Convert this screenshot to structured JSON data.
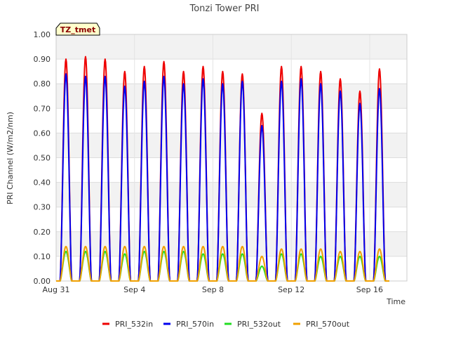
{
  "chart_data": {
    "type": "line",
    "title": "Tonzi Tower PRI",
    "xlabel": "Time",
    "ylabel": "PRI Channel (W/m2/nm)",
    "annotation": "TZ_tmet",
    "ylim": [
      0,
      1.0
    ],
    "yticks": [
      "0.00",
      "0.10",
      "0.20",
      "0.30",
      "0.40",
      "0.50",
      "0.60",
      "0.70",
      "0.80",
      "0.90",
      "1.00"
    ],
    "x_start": "Aug 31",
    "x_end": "Sep 18",
    "xticks": [
      {
        "day": 0,
        "label": "Aug 31"
      },
      {
        "day": 4,
        "label": "Sep 4"
      },
      {
        "day": 8,
        "label": "Sep 8"
      },
      {
        "day": 12,
        "label": "Sep 12"
      },
      {
        "day": 16,
        "label": "Sep 16"
      }
    ],
    "grid": true,
    "legend_position": "bottom",
    "daily_peaks": {
      "days": [
        "Aug 31",
        "Sep 1",
        "Sep 2",
        "Sep 3",
        "Sep 4",
        "Sep 5",
        "Sep 6",
        "Sep 7",
        "Sep 8",
        "Sep 9",
        "Sep 10",
        "Sep 11",
        "Sep 12",
        "Sep 13",
        "Sep 14",
        "Sep 15",
        "Sep 16"
      ],
      "series": [
        {
          "name": "PRI_532in",
          "color": "#ee0000",
          "values": [
            0.9,
            0.91,
            0.9,
            0.85,
            0.87,
            0.89,
            0.85,
            0.87,
            0.85,
            0.84,
            0.68,
            0.87,
            0.87,
            0.85,
            0.82,
            0.77,
            0.86
          ]
        },
        {
          "name": "PRI_570in",
          "color": "#0000ee",
          "values": [
            0.84,
            0.83,
            0.83,
            0.79,
            0.81,
            0.83,
            0.8,
            0.82,
            0.8,
            0.81,
            0.63,
            0.81,
            0.82,
            0.8,
            0.77,
            0.72,
            0.78
          ]
        },
        {
          "name": "PRI_532out",
          "color": "#22dd22",
          "values": [
            0.12,
            0.12,
            0.12,
            0.11,
            0.12,
            0.12,
            0.12,
            0.11,
            0.11,
            0.11,
            0.06,
            0.11,
            0.11,
            0.1,
            0.1,
            0.1,
            0.1
          ]
        },
        {
          "name": "PRI_570out",
          "color": "#f0a000",
          "values": [
            0.14,
            0.14,
            0.14,
            0.14,
            0.14,
            0.14,
            0.14,
            0.14,
            0.14,
            0.14,
            0.1,
            0.13,
            0.13,
            0.13,
            0.12,
            0.12,
            0.13
          ]
        }
      ]
    }
  }
}
